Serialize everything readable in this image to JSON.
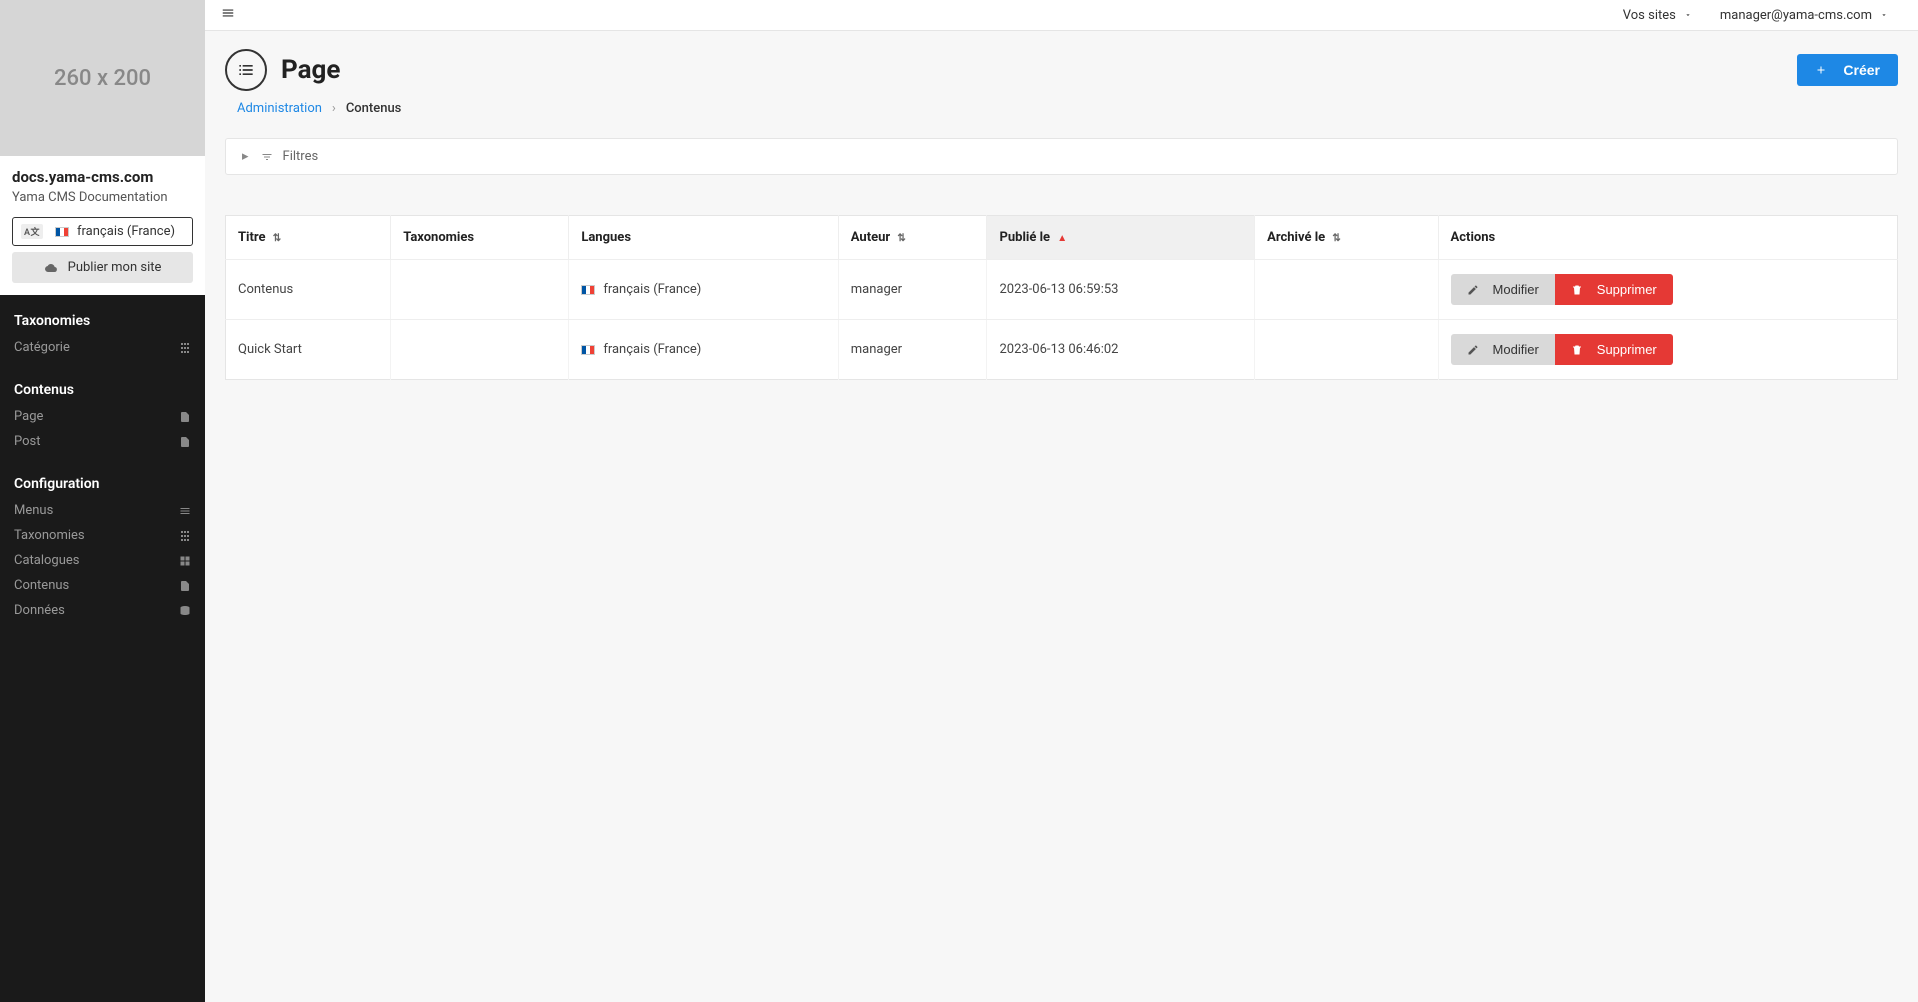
{
  "sidebar": {
    "logo_placeholder": "260 x 200",
    "site_domain": "docs.yama-cms.com",
    "site_desc": "Yama CMS Documentation",
    "lang_badge": "A|B",
    "lang_label": "français (France)",
    "publish_label": "Publier mon site",
    "sections": [
      {
        "title": "Taxonomies",
        "items": [
          {
            "label": "Catégorie",
            "icon": "sitemap"
          }
        ]
      },
      {
        "title": "Contenus",
        "items": [
          {
            "label": "Page",
            "icon": "file"
          },
          {
            "label": "Post",
            "icon": "file"
          }
        ]
      },
      {
        "title": "Configuration",
        "items": [
          {
            "label": "Menus",
            "icon": "list"
          },
          {
            "label": "Taxonomies",
            "icon": "sitemap"
          },
          {
            "label": "Catalogues",
            "icon": "grid"
          },
          {
            "label": "Contenus",
            "icon": "file"
          },
          {
            "label": "Données",
            "icon": "database"
          }
        ]
      }
    ]
  },
  "topbar": {
    "sites_label": "Vos sites",
    "user_email": "manager@yama-cms.com"
  },
  "page": {
    "title": "Page",
    "create_label": "Créer"
  },
  "breadcrumb": {
    "admin": "Administration",
    "current": "Contenus"
  },
  "filters": {
    "label": "Filtres"
  },
  "table": {
    "headers": {
      "titre": "Titre",
      "taxonomies": "Taxonomies",
      "langues": "Langues",
      "auteur": "Auteur",
      "publie": "Publié le",
      "archive": "Archivé le",
      "actions": "Actions"
    },
    "modify_label": "Modifier",
    "delete_label": "Supprimer",
    "rows": [
      {
        "titre": "Contenus",
        "langue": "français (France)",
        "auteur": "manager",
        "publie": "2023-06-13 06:59:53"
      },
      {
        "titre": "Quick Start",
        "langue": "français (France)",
        "auteur": "manager",
        "publie": "2023-06-13 06:46:02"
      }
    ]
  }
}
